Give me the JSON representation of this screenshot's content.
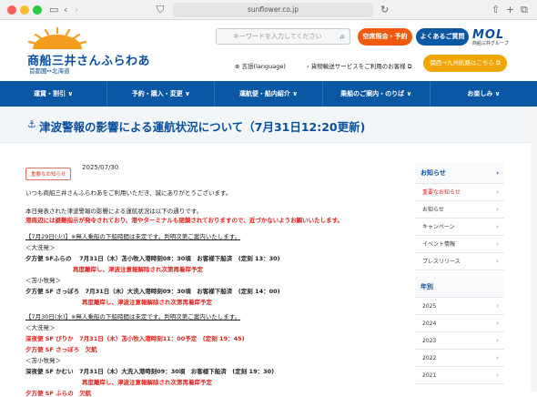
{
  "browser": {
    "url": "sunflower.co.jp",
    "dot_colors": [
      "#ff5f57",
      "#febc2e",
      "#28c840"
    ]
  },
  "header": {
    "logo_main": "商船三井さんふらわあ",
    "logo_sub": "首都圏↔北海道",
    "search_placeholder": "キーワードを入力してください",
    "btn_reserve": "空席照会・予約",
    "btn_faq": "よくあるご質問",
    "mol_title": "MOL",
    "mol_sub": "商船三井グループ",
    "lang_link": "言語(language)",
    "cargo_link": "貨物輸送サービスをご利用のお客様",
    "kyushu_btn": "関西→九州航路はこちら"
  },
  "nav": [
    "運賃・割引 ∨",
    "予約・購入・変更 ∨",
    "運航便・船内紹介 ∨",
    "乗船のご案内・のりば ∨",
    "お楽しみ ∨"
  ],
  "page": {
    "title": "津波警報の影響による運航状況について（7月31日12:20更新)",
    "tag": "重要なお知らせ",
    "date": "2025/07/30"
  },
  "body_lines": [
    {
      "t": "いつも商船三井さんふらわあをご利用いただき、誠にありがとうございます。",
      "c": ""
    },
    {
      "t": "本日発表された津波警報の影響による運航状況は以下の通りです。",
      "c": ""
    },
    {
      "t": "港周辺には避難指示が発令されており、港やターミナルも閉鎖されておりますので、近づかないようお願いいたします。",
      "c": "red bold"
    },
    {
      "t": "【7月29日(火)】※無人乗船の下船時間は未定です。判明次第ご案内いたします。",
      "c": "ul"
    },
    {
      "t": "＜大洗発＞",
      "c": ""
    },
    {
      "t": "夕方便 SFふらの　 7月31日（木）苫小牧入港時刻08：30頃　お客様下船済　(定刻 13：30)",
      "c": "bold"
    },
    {
      "t": "再度離岸し、津波注意報解除され次第再着岸予定",
      "c": "red bold"
    },
    {
      "t": "＜苫小牧発＞",
      "c": ""
    },
    {
      "t": "夕方便 SF さっぽろ　7月31日（木）大洗入港時刻09：30頃　お客様下船済　(定刻 14：00)",
      "c": "bold"
    },
    {
      "t": "再度離岸し、津波注意報解除され次第再着岸予定",
      "c": "red bold"
    },
    {
      "t": "【7月30日(水)】※無人乗船の下船時間は未定です。判明次第ご案内いたします。",
      "c": "ul"
    },
    {
      "t": "＜大洗発＞",
      "c": ""
    },
    {
      "t": "深夜便 SF ぴりか　7月31日（木）苫小牧入港時刻11：00予定　(定刻 19：45)",
      "c": "red bold"
    },
    {
      "t": "夕方便 SF さっぽろ　欠航",
      "c": "red bold"
    },
    {
      "t": "＜苫小牧発＞",
      "c": ""
    },
    {
      "t": "深夜便 SF かむい　7月31日（木）大洗入港時刻09：30頃　お客様下船済　(定刻 19：30)",
      "c": "bold"
    },
    {
      "t": "再度離岸し、津波注意報解除され次第再着岸予定",
      "c": "red bold"
    },
    {
      "t": "夕方便 SF ふらの　欠航",
      "c": "red bold"
    }
  ],
  "sidebar": {
    "head1": "お知らせ",
    "items1": [
      "重要なお知らせ",
      "お知らせ",
      "キャンペーン",
      "イベント情報",
      "プレスリリース"
    ],
    "head2": "年別",
    "items2": [
      "2025",
      "2024",
      "2023",
      "2022",
      "2021"
    ]
  },
  "colors": {
    "brand_blue": "#0a57a4",
    "alert_red": "#e0201a",
    "orange": "#f05a10"
  }
}
